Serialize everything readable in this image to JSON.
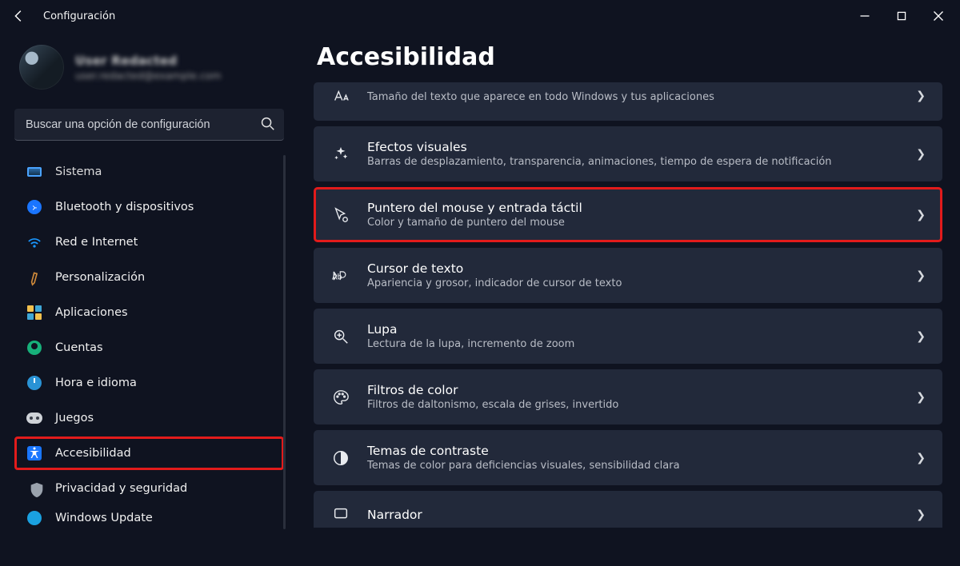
{
  "app_title": "Configuración",
  "user": {
    "name": "User Redacted",
    "email": "user.redacted@example.com"
  },
  "search": {
    "placeholder": "Buscar una opción de configuración"
  },
  "sidebar": {
    "items": [
      {
        "label": "Sistema"
      },
      {
        "label": "Bluetooth y dispositivos"
      },
      {
        "label": "Red e Internet"
      },
      {
        "label": "Personalización"
      },
      {
        "label": "Aplicaciones"
      },
      {
        "label": "Cuentas"
      },
      {
        "label": "Hora e idioma"
      },
      {
        "label": "Juegos"
      },
      {
        "label": "Accesibilidad"
      },
      {
        "label": "Privacidad y seguridad"
      },
      {
        "label": "Windows Update"
      }
    ]
  },
  "page_title": "Accesibilidad",
  "cards": [
    {
      "title": "",
      "desc": "Tamaño del texto que aparece en todo Windows y tus aplicaciones"
    },
    {
      "title": "Efectos visuales",
      "desc": "Barras de desplazamiento, transparencia, animaciones, tiempo de espera de notificación"
    },
    {
      "title": "Puntero del mouse y entrada táctil",
      "desc": "Color y tamaño de puntero del mouse"
    },
    {
      "title": "Cursor de texto",
      "desc": "Apariencia y grosor, indicador de cursor de texto"
    },
    {
      "title": "Lupa",
      "desc": "Lectura de la lupa, incremento de zoom"
    },
    {
      "title": "Filtros de color",
      "desc": "Filtros de daltonismo, escala de grises, invertido"
    },
    {
      "title": "Temas de contraste",
      "desc": "Temas de color para deficiencias visuales, sensibilidad clara"
    },
    {
      "title": "Narrador",
      "desc": ""
    }
  ]
}
